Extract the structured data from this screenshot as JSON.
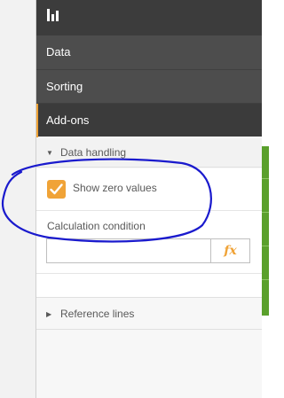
{
  "nav": {
    "items": [
      {
        "label": "Data"
      },
      {
        "label": "Sorting"
      },
      {
        "label": "Add-ons"
      }
    ]
  },
  "sections": {
    "data_handling": {
      "title": "Data handling",
      "show_zero_values": {
        "label": "Show zero values",
        "checked": true
      },
      "calculation_condition": {
        "label": "Calculation condition",
        "value": "",
        "fx_label": "fx"
      }
    },
    "reference_lines": {
      "title": "Reference lines"
    }
  },
  "icons": {
    "toolbar": "bar-chart-icon",
    "expand_open": "caret-down-icon",
    "expand_closed": "caret-right-icon",
    "check": "checkmark-icon"
  },
  "colors": {
    "accent": "#f0a337",
    "nav_bg": "#4d4d4d",
    "annotation": "#1a1acd",
    "green": "#5aa02c"
  }
}
